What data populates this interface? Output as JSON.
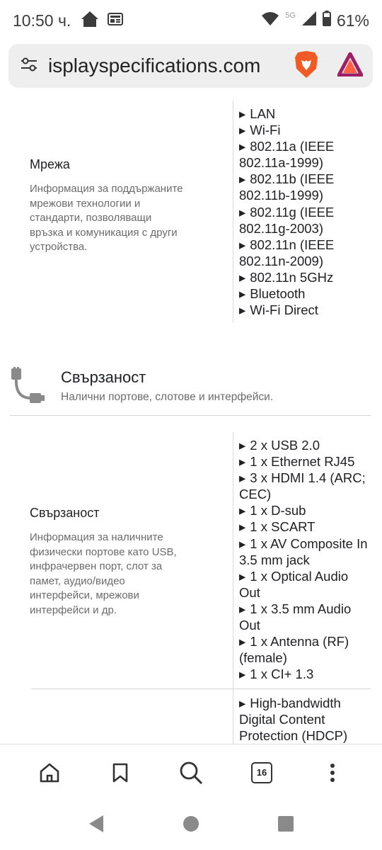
{
  "status": {
    "time": "10:50 ч.",
    "network": "5G",
    "battery": "61%"
  },
  "browser": {
    "url": "isplayspecifications.com",
    "tab_count": "16"
  },
  "network_spec": {
    "title": "Мрежа",
    "description": "Информация за поддържаните мрежови технологии и стандарти, позволяващи връзка и комуникация с други устройства.",
    "values": [
      "LAN",
      "Wi-Fi",
      "802.11a (IEEE 802.11a-1999)",
      "802.11b (IEEE 802.11b-1999)",
      "802.11g (IEEE 802.11g-2003)",
      "802.11n (IEEE 802.11n-2009)",
      "802.11n 5GHz",
      "Bluetooth",
      "Wi-Fi Direct"
    ]
  },
  "connectivity_section": {
    "title": "Свързаност",
    "subtitle": "Налични портове, слотове и интерфейси."
  },
  "connectivity_spec": {
    "title": "Свързаност",
    "description": "Информация за наличните физически портове като USB, инфрачервен порт, слот за памет, аудио/видео интерфейси, мрежови интерфейси и др.",
    "values": [
      "2 x USB 2.0",
      "1 x Ethernet RJ45",
      "3 x HDMI 1.4 (ARC; CEC)",
      "1 x D-sub",
      "1 x SCART",
      "1 x AV Composite In 3.5 mm jack",
      "1 x Optical Audio Out",
      "1 x 3.5 mm Audio Out",
      "1 x Antenna (RF) (female)",
      "1 x CI+ 1.3"
    ]
  },
  "next_spec": {
    "values": [
      "High-bandwidth Digital Content Protection (HDCP)"
    ]
  }
}
